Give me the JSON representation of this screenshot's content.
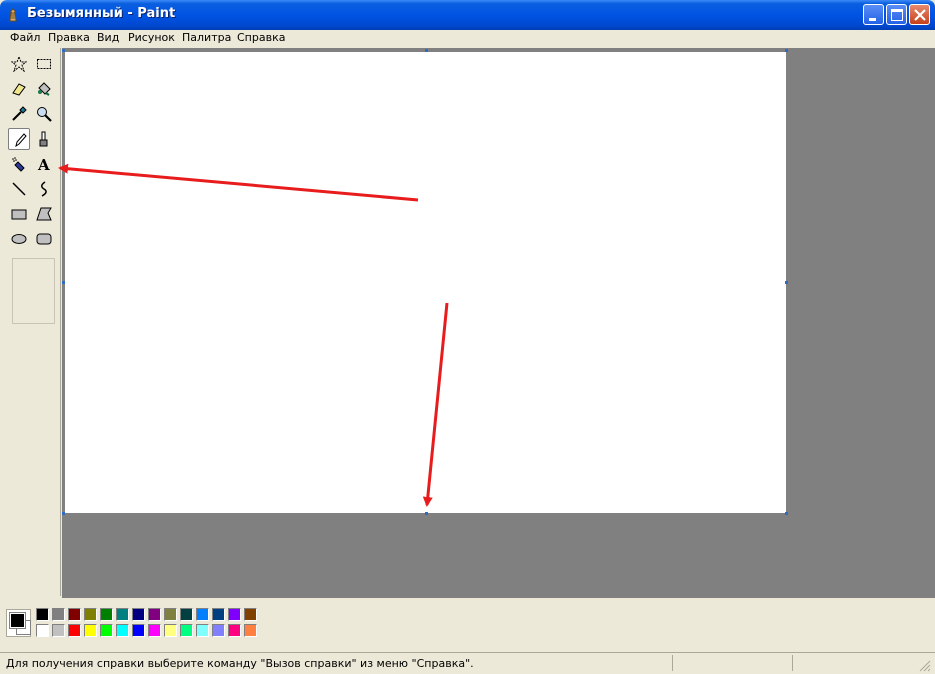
{
  "window": {
    "title": "Безымянный - Paint",
    "icon": "paint-app-icon"
  },
  "title_buttons": [
    "minimize-icon",
    "maximize-icon",
    "close-icon"
  ],
  "menu": {
    "items": [
      "Файл",
      "Правка",
      "Вид",
      "Рисунок",
      "Палитра",
      "Справка"
    ]
  },
  "toolbox": {
    "tools": [
      {
        "id": "free-form-select",
        "icon": "free-form-select-icon"
      },
      {
        "id": "rect-select",
        "icon": "rect-select-icon"
      },
      {
        "id": "eraser",
        "icon": "eraser-icon"
      },
      {
        "id": "fill",
        "icon": "fill-bucket-icon"
      },
      {
        "id": "pick-color",
        "icon": "eyedropper-icon"
      },
      {
        "id": "magnifier",
        "icon": "magnifier-icon"
      },
      {
        "id": "pencil",
        "icon": "pencil-icon",
        "active": true
      },
      {
        "id": "brush",
        "icon": "brush-icon"
      },
      {
        "id": "airbrush",
        "icon": "airbrush-icon"
      },
      {
        "id": "text",
        "icon": "text-tool-icon",
        "glyph": "A"
      },
      {
        "id": "line",
        "icon": "line-icon"
      },
      {
        "id": "curve",
        "icon": "curve-icon"
      },
      {
        "id": "rectangle",
        "icon": "rectangle-icon"
      },
      {
        "id": "polygon",
        "icon": "polygon-icon"
      },
      {
        "id": "ellipse",
        "icon": "ellipse-icon"
      },
      {
        "id": "rounded-rectangle",
        "icon": "rounded-rectangle-icon"
      }
    ]
  },
  "palette": {
    "foreground": "#000000",
    "background": "#ffffff",
    "top_row": [
      "#000000",
      "#808080",
      "#800000",
      "#808000",
      "#008000",
      "#008080",
      "#000080",
      "#800080",
      "#808040",
      "#004040",
      "#0080ff",
      "#004080",
      "#8000ff",
      "#804000"
    ],
    "bottom_row": [
      "#ffffff",
      "#c0c0c0",
      "#ff0000",
      "#ffff00",
      "#00ff00",
      "#00ffff",
      "#0000ff",
      "#ff00ff",
      "#ffff80",
      "#00ff80",
      "#80ffff",
      "#8080ff",
      "#ff0080",
      "#ff8040"
    ]
  },
  "status": {
    "text": "Для получения справки выберите команду \"Вызов справки\" из меню \"Справка\"."
  },
  "annotations": {
    "arrow_color": "#e81c1c"
  }
}
